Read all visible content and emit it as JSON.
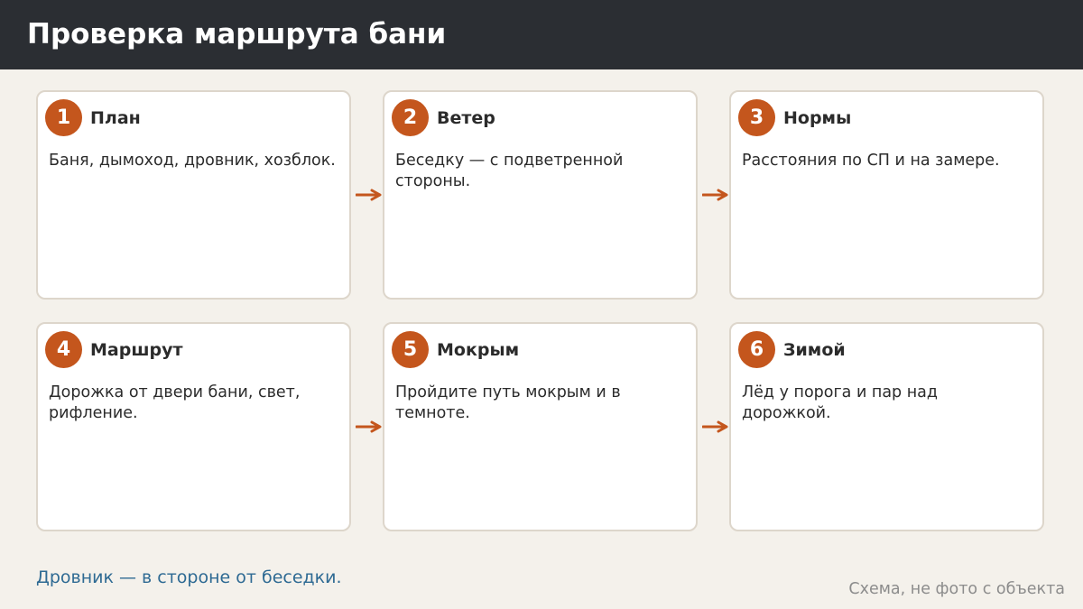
{
  "header": {
    "title": "Проверка маршрута бани"
  },
  "steps": [
    {
      "number": "1",
      "title": "План",
      "text": "Баня, дымоход, дровник, хозблок."
    },
    {
      "number": "2",
      "title": "Ветер",
      "text": "Беседку — с подветренной стороны."
    },
    {
      "number": "3",
      "title": "Нормы",
      "text": "Расстояния по СП и на замере."
    },
    {
      "number": "4",
      "title": "Маршрут",
      "text": "Дорожка от двери бани, свет, рифление."
    },
    {
      "number": "5",
      "title": "Мокрым",
      "text": "Пройдите путь мокрым и в темноте."
    },
    {
      "number": "6",
      "title": "Зимой",
      "text": "Лёд у порога и пар над дорожкой."
    }
  ],
  "footnote": "Дровник — в стороне от беседки.",
  "caption": "Схема, не фото с объекта",
  "colors": {
    "accent": "#c4561d",
    "header_bg": "#2b2e33",
    "footnote": "#2e6a93"
  },
  "icons": {
    "connector": "arrow-right-icon"
  }
}
